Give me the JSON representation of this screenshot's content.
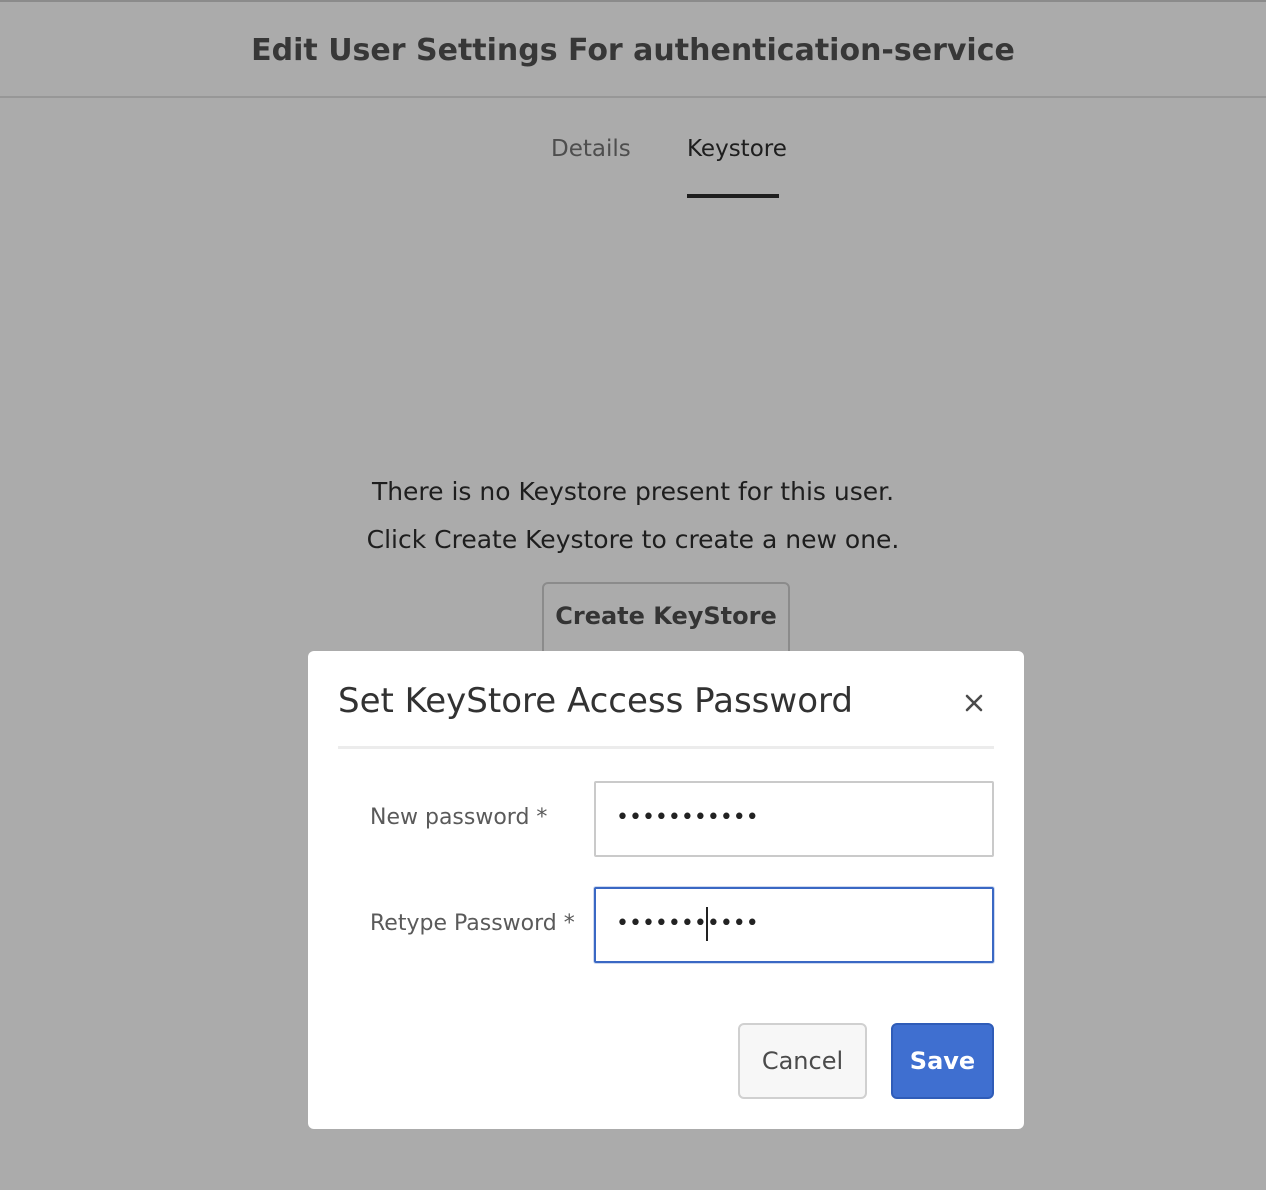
{
  "header": {
    "title": "Edit User Settings For authentication-service"
  },
  "tabs": [
    {
      "label": "Details",
      "active": false
    },
    {
      "label": "Keystore",
      "active": true
    }
  ],
  "empty_state": {
    "line1": "There is no Keystore present for this user.",
    "line2": "Click Create Keystore to create a new one.",
    "create_button_label": "Create KeyStore"
  },
  "dialog": {
    "title": "Set KeyStore Access Password",
    "close_icon": "close-icon",
    "fields": {
      "new_password": {
        "label": "New password *",
        "masked_value": "•••••••••••"
      },
      "retype_password": {
        "label": "Retype Password *",
        "masked_value": "•••••••••••"
      }
    },
    "cancel_label": "Cancel",
    "save_label": "Save"
  },
  "colors": {
    "primary_button": "#3f6fd0",
    "focus_border": "#3a68c4",
    "active_tab_underline": "#2c2c2c"
  }
}
